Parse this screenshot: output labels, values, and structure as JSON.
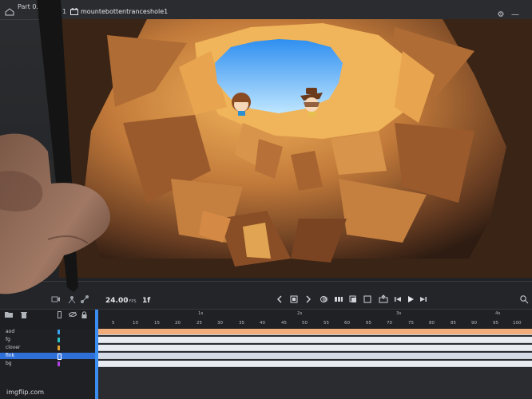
{
  "titlebar": {
    "tab_label": "Part 0.fla",
    "frame_number": "1",
    "scene_name": "mountebottentranceshole1"
  },
  "timeline": {
    "fps_value": "24.00",
    "fps_unit": "FPS",
    "loop_label": "1f",
    "ruler_numbers": [
      "5",
      "10",
      "15",
      "20",
      "25",
      "30",
      "35",
      "40",
      "45",
      "50",
      "55",
      "60",
      "65",
      "70",
      "75",
      "80",
      "85",
      "90",
      "95",
      "100"
    ],
    "seconds_labels": [
      "1s",
      "2s",
      "3s",
      "4s"
    ],
    "layers": [
      {
        "name": "aod",
        "color": "#3aa0f0"
      },
      {
        "name": "fg",
        "color": "#2ac3c8"
      },
      {
        "name": "clover",
        "color": "#e0a030"
      },
      {
        "name": "fink",
        "color": "#3a7ef0",
        "selected": true
      },
      {
        "name": "bg",
        "color": "#b040e0"
      }
    ]
  },
  "watermark": "imgflip.com"
}
